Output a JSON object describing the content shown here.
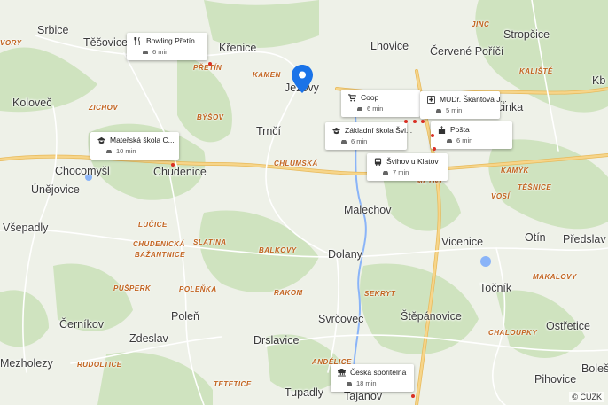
{
  "map": {
    "attribution": "© ČÚZK",
    "selected_place": "Ježovy",
    "places": [
      {
        "id": "srbice",
        "name": "Srbice"
      },
      {
        "id": "tesovice",
        "name": "Těšovice"
      },
      {
        "id": "krenice",
        "name": "Křenice"
      },
      {
        "id": "lhovice",
        "name": "Lhovice"
      },
      {
        "id": "cervene-porici",
        "name": "Červené Poříčí"
      },
      {
        "id": "stropcice",
        "name": "Stropčice"
      },
      {
        "id": "kolovec",
        "name": "Koloveč"
      },
      {
        "id": "jezovy",
        "name": "Ježovy"
      },
      {
        "id": "trnci",
        "name": "Trnčí"
      },
      {
        "id": "chocomysl",
        "name": "Chocomyšl"
      },
      {
        "id": "chudenice",
        "name": "Chudenice"
      },
      {
        "id": "unejovice",
        "name": "Únějovice"
      },
      {
        "id": "vsepadly",
        "name": "Všepadly"
      },
      {
        "id": "malechov",
        "name": "Malechov"
      },
      {
        "id": "vicenice",
        "name": "Vicenice"
      },
      {
        "id": "otin",
        "name": "Otín"
      },
      {
        "id": "predslav",
        "name": "Předslav"
      },
      {
        "id": "dolany",
        "name": "Dolany"
      },
      {
        "id": "tocnik",
        "name": "Točník"
      },
      {
        "id": "cernikov",
        "name": "Černíkov"
      },
      {
        "id": "polen",
        "name": "Poleň"
      },
      {
        "id": "svrcovec",
        "name": "Svrčovec"
      },
      {
        "id": "stepanovice",
        "name": "Štěpánovice"
      },
      {
        "id": "zdeslav",
        "name": "Zdeslav"
      },
      {
        "id": "drslavice",
        "name": "Drslavice"
      },
      {
        "id": "ostretice",
        "name": "Ostřetice"
      },
      {
        "id": "mezholezy",
        "name": "Mezholezy"
      },
      {
        "id": "pihovice",
        "name": "Pihovice"
      },
      {
        "id": "tupadly",
        "name": "Tupadly"
      },
      {
        "id": "bolesi",
        "name": "Boleši"
      },
      {
        "id": "tajanov",
        "name": "Tajanov"
      },
      {
        "id": "kb",
        "name": "Kb"
      },
      {
        "id": "vorin",
        "name": "VORY"
      },
      {
        "id": "cinka",
        "name": "cinka"
      },
      {
        "id": "jinc",
        "name": "JINC"
      }
    ],
    "localities": [
      {
        "id": "kamen",
        "name": "KAMEN"
      },
      {
        "id": "pretin",
        "name": "PŘETÍN"
      },
      {
        "id": "zichov",
        "name": "ZICHOV"
      },
      {
        "id": "bysov",
        "name": "BÝŠOV"
      },
      {
        "id": "chlumska",
        "name": "CHLUMSKÁ"
      },
      {
        "id": "lucice",
        "name": "LUČICE"
      },
      {
        "id": "chudenicka",
        "name": "CHUDENICKÁ"
      },
      {
        "id": "bazantnice",
        "name": "BAŽANTNICE"
      },
      {
        "id": "slatina",
        "name": "SLATINA"
      },
      {
        "id": "balkovy",
        "name": "BALKOVY"
      },
      {
        "id": "pusperk",
        "name": "PUŠPERK"
      },
      {
        "id": "polenka",
        "name": "POLEŇKA"
      },
      {
        "id": "rakom",
        "name": "RAKOM"
      },
      {
        "id": "sekryt",
        "name": "SEKRYT"
      },
      {
        "id": "makalovy",
        "name": "MAKALOVY"
      },
      {
        "id": "chaloupky",
        "name": "CHALOUPKY"
      },
      {
        "id": "rudoltice",
        "name": "RUDOLTICE"
      },
      {
        "id": "tetetice",
        "name": "TETETICE"
      },
      {
        "id": "andelice",
        "name": "ANDĚLICE"
      },
      {
        "id": "kalista",
        "name": "KALIŠTĚ"
      },
      {
        "id": "kamyk",
        "name": "KAMÝK"
      },
      {
        "id": "tesnice",
        "name": "TĚŠNICE"
      },
      {
        "id": "vose",
        "name": "VOSÍ"
      },
      {
        "id": "mlyny",
        "name": "MLÝNY"
      }
    ],
    "pois": [
      {
        "id": "bowling",
        "name": "Bowling Přetín",
        "time": "6 min",
        "icon": "restaurant-icon"
      },
      {
        "id": "materska",
        "name": "Mateřská škola C...",
        "time": "10 min",
        "icon": "school-icon"
      },
      {
        "id": "coop",
        "name": "Coop",
        "time": "6 min",
        "icon": "shopping-cart-icon"
      },
      {
        "id": "mudr",
        "name": "MUDr. Škantová J...",
        "time": "5 min",
        "icon": "medical-icon"
      },
      {
        "id": "zakladni",
        "name": "Základní škola Švi...",
        "time": "6 min",
        "icon": "school-icon"
      },
      {
        "id": "posta",
        "name": "Pošta",
        "time": "6 min",
        "icon": "post-office-icon"
      },
      {
        "id": "sihov",
        "name": "Švihov u Klatov",
        "time": "7 min",
        "icon": "bus-icon"
      },
      {
        "id": "sporitelna",
        "name": "Česká spořitelna",
        "time": "18 min",
        "icon": "bank-icon"
      }
    ],
    "colors": {
      "background": "#eef1e8",
      "forest": "#cfe3bf",
      "road": "#f6d58a",
      "road_edge": "#e8b959",
      "river": "#8ab4f8",
      "marker": "#1a73e8"
    }
  }
}
